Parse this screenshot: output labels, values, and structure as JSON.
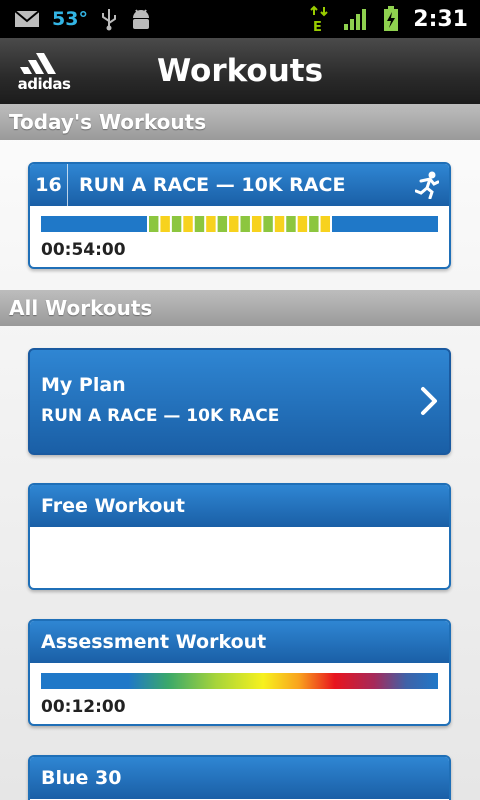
{
  "status_bar": {
    "temperature": "53°",
    "time": "2:31",
    "network": "E"
  },
  "header": {
    "logo_text": "adidas",
    "title": "Workouts"
  },
  "sections": {
    "today": "Today's Workouts",
    "all": "All Workouts"
  },
  "today_workout": {
    "day": "16",
    "name": "RUN A RACE — 10K RACE",
    "duration": "00:54:00",
    "zones": [
      "blue",
      "green",
      "yellow",
      "green",
      "yellow",
      "green",
      "yellow",
      "green",
      "yellow",
      "green",
      "yellow",
      "green",
      "yellow",
      "green",
      "yellow",
      "green",
      "yellow",
      "blue"
    ]
  },
  "my_plan": {
    "title": "My Plan",
    "subtitle": "RUN A RACE — 10K RACE"
  },
  "free_workout": {
    "title": "Free Workout"
  },
  "assessment": {
    "title": "Assessment Workout",
    "duration": "00:12:00"
  },
  "blue30": {
    "title": "Blue 30"
  },
  "colors": {
    "blue_zone": "#1f78c8",
    "green_zone": "#8cc63f",
    "yellow_zone": "#f7d21e",
    "accent": "#1f6fb7"
  }
}
